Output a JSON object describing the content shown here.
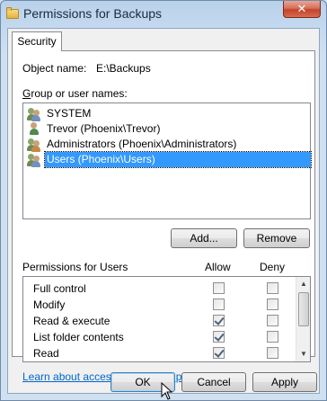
{
  "window": {
    "title": "Permissions for Backups",
    "close_label": "✕"
  },
  "tabs": [
    {
      "label": "Security"
    }
  ],
  "object": {
    "label": "Object name:",
    "value": "E:\\Backups"
  },
  "groups": {
    "label": "Group or user names:",
    "items": [
      {
        "label": "SYSTEM",
        "icon": "users-icon"
      },
      {
        "label": "Trevor (Phoenix\\Trevor)",
        "icon": "user-icon"
      },
      {
        "label": "Administrators (Phoenix\\Administrators)",
        "icon": "users-icon"
      },
      {
        "label": "Users (Phoenix\\Users)",
        "icon": "users-icon",
        "selected": true
      }
    ]
  },
  "buttons": {
    "add": "Add...",
    "remove": "Remove",
    "ok": "OK",
    "cancel": "Cancel",
    "apply": "Apply"
  },
  "permissions": {
    "label": "Permissions for Users",
    "allow_header": "Allow",
    "deny_header": "Deny",
    "rows": [
      {
        "name": "Full control",
        "allow": false,
        "deny": false
      },
      {
        "name": "Modify",
        "allow": false,
        "deny": false
      },
      {
        "name": "Read & execute",
        "allow": true,
        "deny": false
      },
      {
        "name": "List folder contents",
        "allow": true,
        "deny": false
      },
      {
        "name": "Read",
        "allow": true,
        "deny": false
      }
    ]
  },
  "link": "Learn about access control and permissions"
}
